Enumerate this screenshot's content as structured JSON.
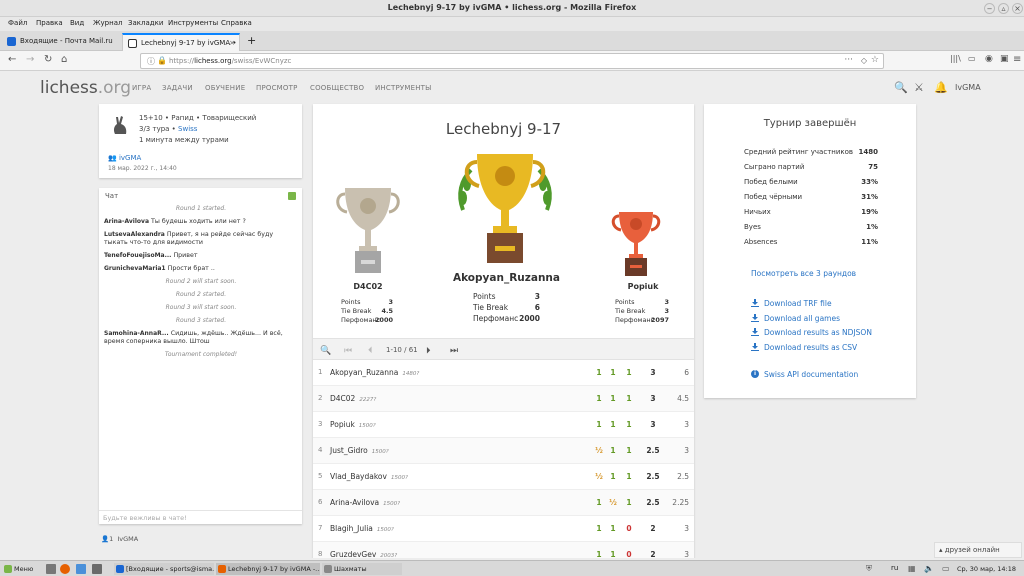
{
  "window": {
    "title": "Lechebnyj 9-17 by ivGMA • lichess.org - Mozilla Firefox"
  },
  "menu": [
    "Файл",
    "Правка",
    "Вид",
    "Журнал",
    "Закладки",
    "Инструменты",
    "Справка"
  ],
  "tabs": [
    {
      "label": "Входящие - Почта Mail.ru",
      "active": false
    },
    {
      "label": "Lechebnyj 9-17 by ivGMA • lic",
      "active": true
    }
  ],
  "url": {
    "prefix": "https://",
    "domain": "lichess.org",
    "path": "/swiss/EvWCnyzc"
  },
  "site": {
    "logo_main": "lichess",
    "logo_tld": ".org",
    "nav": [
      "ИГРА",
      "ЗАДАЧИ",
      "ОБУЧЕНИЕ",
      "ПРОСМОТР",
      "СООБЩЕСТВО",
      "ИНСТРУМЕНТЫ"
    ],
    "username": "IvGMA"
  },
  "info": {
    "line1": "15+10 • Рапид • Товарищеский",
    "rounds": "3/3 тура • ",
    "format": "Swiss",
    "interval": "1 минута между турами",
    "creator": "ivGMA",
    "date": "18 мар. 2022 г., 14:40"
  },
  "chat": {
    "title": "Чат",
    "messages": [
      {
        "type": "sys",
        "text": "Round 1 started."
      },
      {
        "type": "msg",
        "user": "Arina-Avilova",
        "text": "Ты будешь ходить или нет ?"
      },
      {
        "type": "msg",
        "user": "LutsevaAlexandra",
        "text": "Привет, я на рейде сейчас буду тыкать что-то для видимости"
      },
      {
        "type": "msg",
        "user": "TenefoFouejisoMa...",
        "text": "Привет"
      },
      {
        "type": "msg",
        "user": "GrunichevaMaria1",
        "text": "Прости брат .."
      },
      {
        "type": "sys",
        "text": "Round 2 will start soon."
      },
      {
        "type": "sys",
        "text": "Round 2 started."
      },
      {
        "type": "sys",
        "text": "Round 3 will start soon."
      },
      {
        "type": "sys",
        "text": "Round 3 started."
      },
      {
        "type": "msg",
        "user": "Samohina-AnnaR...",
        "text": "Сидишь, ждёшь.. Ждёшь... И всё, время соперника вышло. Штош"
      },
      {
        "type": "sys",
        "text": "Tournament completed!"
      }
    ],
    "placeholder": "Будьте вежливы в чате!",
    "spectators": "1",
    "spectator_name": "IvGMA"
  },
  "tournament": {
    "title": "Lechebnyj 9-17",
    "podium": [
      {
        "place": 1,
        "name": "Akopyan_Ruzanna",
        "points": "3",
        "tiebreak": "6",
        "perf": "2000"
      },
      {
        "place": 2,
        "name": "D4C02",
        "points": "3",
        "tiebreak": "4.5",
        "perf": "2000"
      },
      {
        "place": 3,
        "name": "Popiuk",
        "points": "3",
        "tiebreak": "3",
        "perf": "2097"
      }
    ],
    "labels": {
      "points": "Points",
      "tiebreak": "Tie Break",
      "perf": "Перфоманс"
    },
    "pager": "1-10 / 61",
    "standings": [
      {
        "rank": "1",
        "name": "Akopyan_Ruzanna",
        "rating": "1480?",
        "results": [
          "1",
          "1",
          "1"
        ],
        "points": "3",
        "tb": "6"
      },
      {
        "rank": "2",
        "name": "D4C02",
        "rating": "2227?",
        "results": [
          "1",
          "1",
          "1"
        ],
        "points": "3",
        "tb": "4.5"
      },
      {
        "rank": "3",
        "name": "Popiuk",
        "rating": "1500?",
        "results": [
          "1",
          "1",
          "1"
        ],
        "points": "3",
        "tb": "3"
      },
      {
        "rank": "4",
        "name": "Just_Gidro",
        "rating": "1500?",
        "results": [
          "½",
          "1",
          "1"
        ],
        "points": "2.5",
        "tb": "3"
      },
      {
        "rank": "5",
        "name": "Vlad_Baydakov",
        "rating": "1500?",
        "results": [
          "½",
          "1",
          "1"
        ],
        "points": "2.5",
        "tb": "2.5"
      },
      {
        "rank": "6",
        "name": "Arina-Avilova",
        "rating": "1500?",
        "results": [
          "1",
          "½",
          "1"
        ],
        "points": "2.5",
        "tb": "2.25"
      },
      {
        "rank": "7",
        "name": "Blagih_Julia",
        "rating": "1500?",
        "results": [
          "1",
          "1",
          "0"
        ],
        "points": "2",
        "tb": "3"
      },
      {
        "rank": "8",
        "name": "GruzdevGev",
        "rating": "2003?",
        "results": [
          "1",
          "1",
          "0"
        ],
        "points": "2",
        "tb": "3"
      }
    ]
  },
  "summary": {
    "title": "Турнир завершён",
    "stats": [
      {
        "label": "Средний рейтинг участников",
        "value": "1480"
      },
      {
        "label": "Сыграно партий",
        "value": "75"
      },
      {
        "label": "Побед белыми",
        "value": "33%"
      },
      {
        "label": "Побед чёрными",
        "value": "31%"
      },
      {
        "label": "Ничьих",
        "value": "19%"
      },
      {
        "label": "Byes",
        "value": "1%"
      },
      {
        "label": "Absences",
        "value": "11%"
      }
    ],
    "view_rounds": "Посмотреть все 3 раундов",
    "downloads": [
      "Download TRF file",
      "Download all games",
      "Download results as NDJSON",
      "Download results as CSV"
    ],
    "api": "Swiss API documentation"
  },
  "friends": "друзей онлайн",
  "taskbar": {
    "menu": "Меню",
    "items": [
      "[Входящие - sports@isma...",
      "Lechebnyj 9-17 by ivGMA -...",
      "Шахматы"
    ],
    "lang": "ru",
    "clock": "Ср, 30 мар, 14:18"
  },
  "colors": {
    "win": "#629924",
    "draw": "#d79a32",
    "loss": "#cc3333",
    "link": "#2a74c4",
    "gold": "#e8b923",
    "silver": "#c9c0b0",
    "bronze": "#e8603c"
  }
}
